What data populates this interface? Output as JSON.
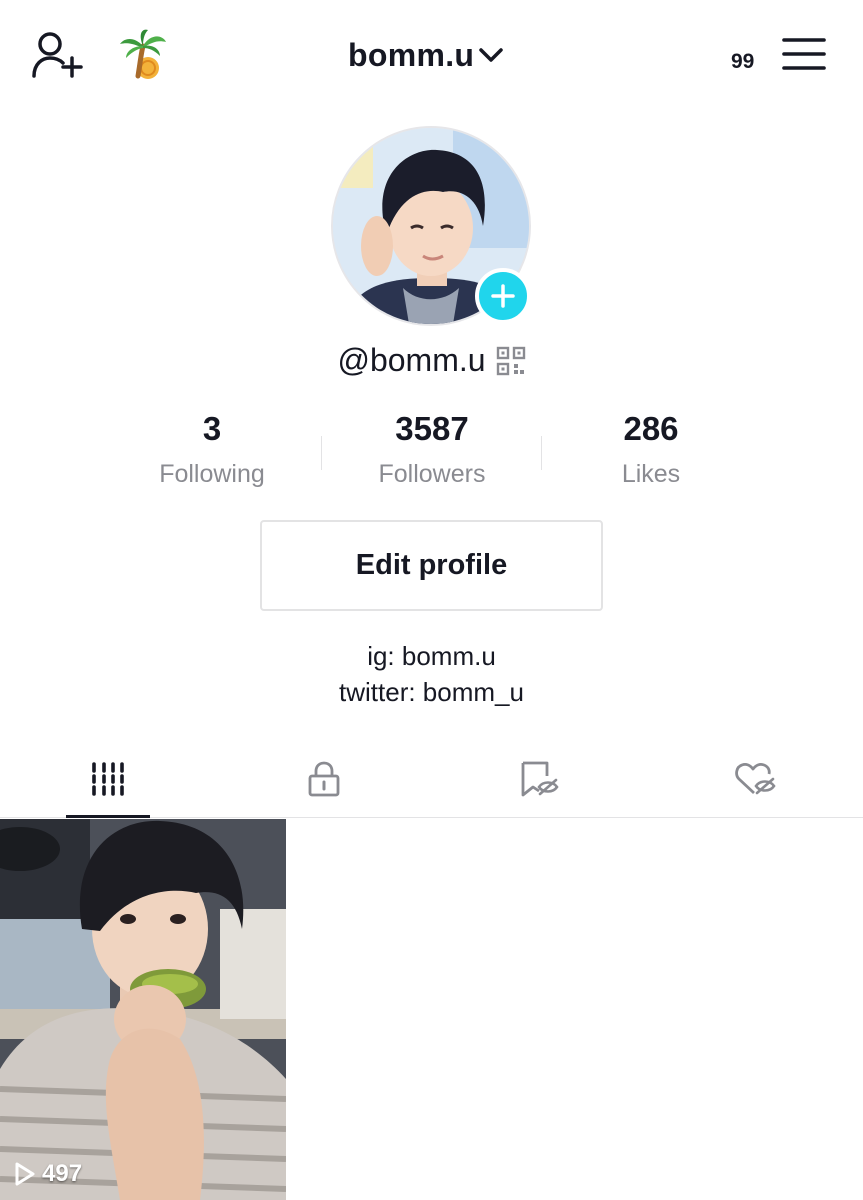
{
  "header": {
    "username": "bomm.u",
    "notification_count": "99",
    "icons": {
      "add_user": "add-user-icon",
      "palm": "palm-tree-coin-icon",
      "switch": "chevron-down-icon",
      "menu": "hamburger-menu-icon"
    }
  },
  "profile": {
    "handle": "@bomm.u",
    "avatar_badge_icon": "plus-icon",
    "qr_icon": "qr-code-icon",
    "accent_color": "#20d5ec"
  },
  "stats": [
    {
      "value": "3",
      "label": "Following"
    },
    {
      "value": "3587",
      "label": "Followers"
    },
    {
      "value": "286",
      "label": "Likes"
    }
  ],
  "edit_profile_label": "Edit profile",
  "bio": {
    "line1": "ig: bomm.u",
    "line2": "twitter: bomm_u"
  },
  "tabs": [
    {
      "name": "videos",
      "icon": "grid-icon",
      "active": true
    },
    {
      "name": "private",
      "icon": "lock-icon",
      "active": false
    },
    {
      "name": "bookmarked",
      "icon": "bookmark-hidden-icon",
      "active": false
    },
    {
      "name": "liked",
      "icon": "heart-hidden-icon",
      "active": false
    }
  ],
  "videos": [
    {
      "views": "497",
      "icon": "play-icon"
    }
  ]
}
